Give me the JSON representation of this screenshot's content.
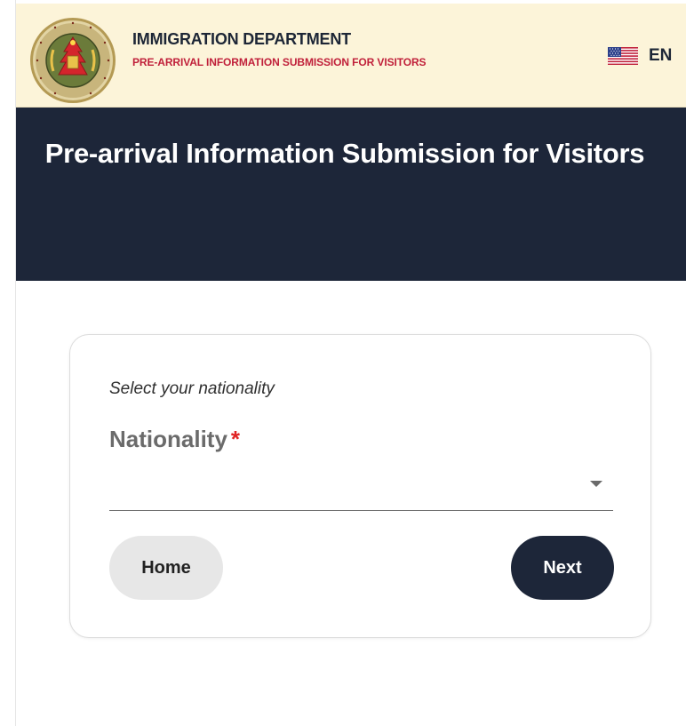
{
  "header": {
    "emblem_icon": "immigration-emblem-icon",
    "emblem_text_top": "CỤC QUẢN LÝ XUẤT NHẬP CẢNH",
    "emblem_text_bottom": "IMMIGRATION",
    "title": "IMMIGRATION DEPARTMENT",
    "subtitle": "PRE-ARRIVAL INFORMATION SUBMISSION FOR VISITORS",
    "language": {
      "flag_icon": "us-flag-icon",
      "code": "EN"
    }
  },
  "hero": {
    "title": "Pre-arrival Information Submission for Visitors"
  },
  "form": {
    "hint": "Select your nationality",
    "nationality_label": "Nationality",
    "required_marker": "*",
    "nationality_value": "",
    "dropdown_icon": "caret-down-icon"
  },
  "actions": {
    "home_label": "Home",
    "next_label": "Next"
  },
  "colors": {
    "header_bg": "#fcf4d9",
    "hero_bg": "#1d2639",
    "subtitle_red": "#c0203a",
    "required_red": "#e02424",
    "next_button_bg": "#1d2639",
    "home_button_bg": "#e7e7e7"
  }
}
